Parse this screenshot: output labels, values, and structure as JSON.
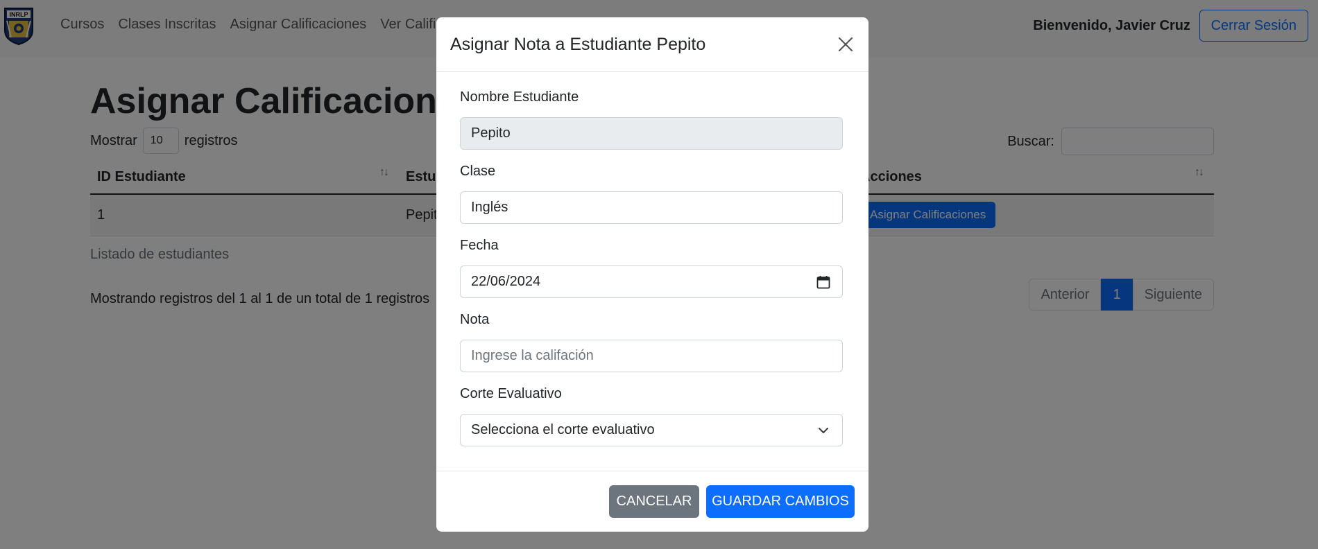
{
  "nav": {
    "links": [
      "Cursos",
      "Clases Inscritas",
      "Asignar Calificaciones",
      "Ver Calificaciones"
    ],
    "welcome": "Bienvenido, Javier Cruz",
    "logout": "Cerrar Sesión",
    "logo_text": "INRLP"
  },
  "page": {
    "title": "Asignar Calificaciones",
    "show_label": "Mostrar",
    "show_value": "10",
    "records_label": "registros",
    "search_label": "Buscar:",
    "columns": [
      "ID Estudiante",
      "Estudiante",
      "Acciones"
    ],
    "rows": [
      {
        "id": "1",
        "name": "Pepito",
        "action": "Asignar Calificaciones"
      }
    ],
    "caption": "Listado de estudiantes",
    "info": "Mostrando registros del 1 al 1 de un total de 1 registros",
    "pagination": {
      "prev": "Anterior",
      "current": "1",
      "next": "Siguiente"
    }
  },
  "modal": {
    "title": "Asignar Nota a Estudiante Pepito",
    "fields": {
      "name_label": "Nombre Estudiante",
      "name_value": "Pepito",
      "class_label": "Clase",
      "class_value": "Inglés",
      "date_label": "Fecha",
      "date_value": "22/06/2024",
      "grade_label": "Nota",
      "grade_placeholder": "Ingrese la califación",
      "period_label": "Corte Evaluativo",
      "period_value": "Selecciona el corte evaluativo"
    },
    "cancel": "CANCELAR",
    "save": "GUARDAR CAMBIOS"
  },
  "colors": {
    "primary": "#0d6efd",
    "secondary": "#6c757d",
    "backdrop": "rgba(0,0,0,0.5)"
  },
  "icons": [
    "logo-shield-icon",
    "sort-icon",
    "close-icon",
    "calendar-icon",
    "chevron-down-icon"
  ]
}
